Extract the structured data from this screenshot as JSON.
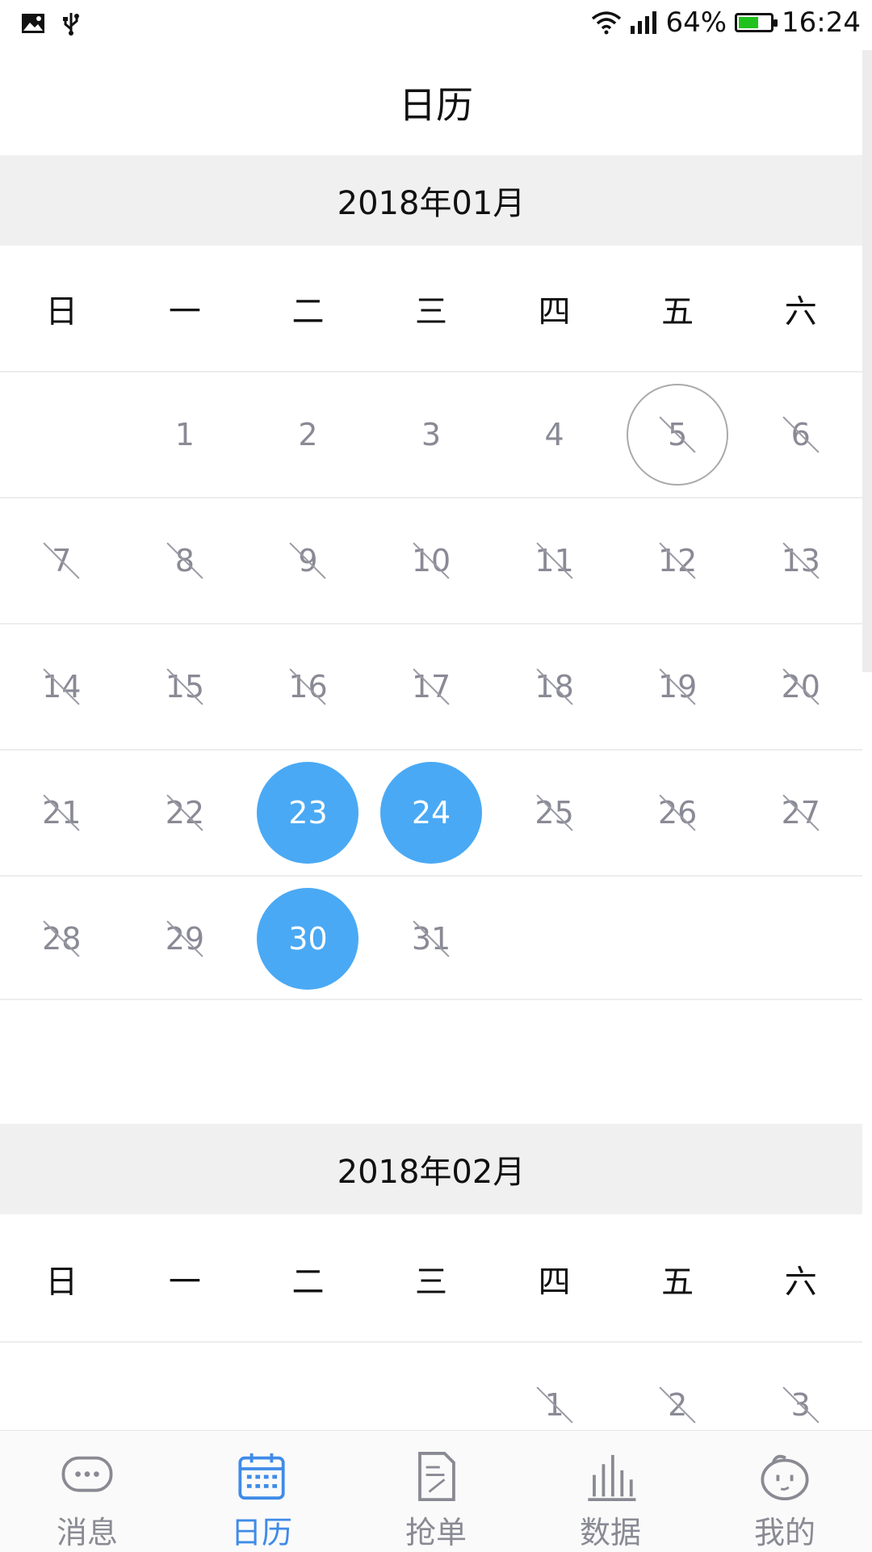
{
  "status_bar": {
    "battery": "64%",
    "time": "16:24",
    "battery_level": 0.64,
    "battery_color": "#21c21d",
    "icons": [
      "image-icon",
      "usb-icon",
      "wifi-icon",
      "signal-icon",
      "battery-icon"
    ]
  },
  "header": {
    "title": "日历"
  },
  "weekdays": [
    "日",
    "一",
    "二",
    "三",
    "四",
    "五",
    "六"
  ],
  "colors": {
    "selected": "#4aa9f4",
    "active_tab": "#3f8be8",
    "day_text": "#8a8a96"
  },
  "months": [
    {
      "label": "2018年01月",
      "weeks": [
        [
          {
            "d": ""
          },
          {
            "d": "1"
          },
          {
            "d": "2"
          },
          {
            "d": "3"
          },
          {
            "d": "4"
          },
          {
            "d": "5",
            "state": "today-disabled"
          },
          {
            "d": "6",
            "state": "disabled"
          }
        ],
        [
          {
            "d": "7",
            "state": "disabled"
          },
          {
            "d": "8",
            "state": "disabled"
          },
          {
            "d": "9",
            "state": "disabled"
          },
          {
            "d": "10",
            "state": "disabled"
          },
          {
            "d": "11",
            "state": "disabled"
          },
          {
            "d": "12",
            "state": "disabled"
          },
          {
            "d": "13",
            "state": "disabled"
          }
        ],
        [
          {
            "d": "14",
            "state": "disabled"
          },
          {
            "d": "15",
            "state": "disabled"
          },
          {
            "d": "16",
            "state": "disabled"
          },
          {
            "d": "17",
            "state": "disabled"
          },
          {
            "d": "18",
            "state": "disabled"
          },
          {
            "d": "19",
            "state": "disabled"
          },
          {
            "d": "20",
            "state": "disabled"
          }
        ],
        [
          {
            "d": "21",
            "state": "disabled"
          },
          {
            "d": "22",
            "state": "disabled"
          },
          {
            "d": "23",
            "state": "selected"
          },
          {
            "d": "24",
            "state": "selected"
          },
          {
            "d": "25",
            "state": "disabled"
          },
          {
            "d": "26",
            "state": "disabled"
          },
          {
            "d": "27",
            "state": "disabled"
          }
        ],
        [
          {
            "d": "28",
            "state": "disabled"
          },
          {
            "d": "29",
            "state": "disabled"
          },
          {
            "d": "30",
            "state": "selected"
          },
          {
            "d": "31",
            "state": "disabled"
          },
          {
            "d": ""
          },
          {
            "d": ""
          },
          {
            "d": ""
          }
        ]
      ]
    },
    {
      "label": "2018年02月",
      "weeks": [
        [
          {
            "d": ""
          },
          {
            "d": ""
          },
          {
            "d": ""
          },
          {
            "d": ""
          },
          {
            "d": "1",
            "state": "disabled"
          },
          {
            "d": "2",
            "state": "disabled"
          },
          {
            "d": "3",
            "state": "disabled"
          }
        ]
      ]
    }
  ],
  "tabs": [
    {
      "label": "消息",
      "icon": "message-icon",
      "active": false
    },
    {
      "label": "日历",
      "icon": "calendar-icon",
      "active": true
    },
    {
      "label": "抢单",
      "icon": "order-icon",
      "active": false
    },
    {
      "label": "数据",
      "icon": "chart-icon",
      "active": false
    },
    {
      "label": "我的",
      "icon": "profile-icon",
      "active": false
    }
  ]
}
